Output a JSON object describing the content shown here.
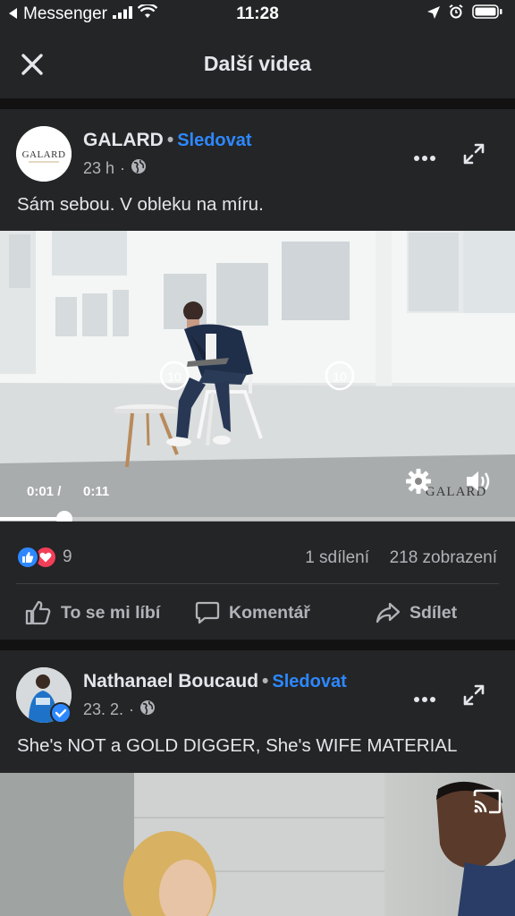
{
  "status_bar": {
    "back_app": "Messenger",
    "time": "11:28"
  },
  "header": {
    "title": "Další videa"
  },
  "posts": [
    {
      "author": "GALARD",
      "follow_label": "Sledovat",
      "time": "23 h",
      "avatar_text": "GALARD",
      "caption": "Sám sebou. V obleku na míru.",
      "video": {
        "current_time": "0:01 /",
        "duration": "0:11",
        "progress_fraction": 0.125,
        "rewind_label": "10",
        "forward_label": "10",
        "watermark": "GALARD"
      },
      "reaction_count": "9",
      "shares": "1 sdílení",
      "views": "218 zobrazení",
      "actions": {
        "like": "To se mi líbí",
        "comment": "Komentář",
        "share": "Sdílet"
      }
    },
    {
      "author": "Nathanael Boucaud",
      "follow_label": "Sledovat",
      "time": "23. 2.",
      "caption": "She's NOT a GOLD DIGGER, She's WIFE MATERIAL"
    }
  ],
  "colors": {
    "background": "#18191a",
    "card": "#242526",
    "accent": "#2d88ff",
    "secondary_text": "#b0b3b8"
  }
}
